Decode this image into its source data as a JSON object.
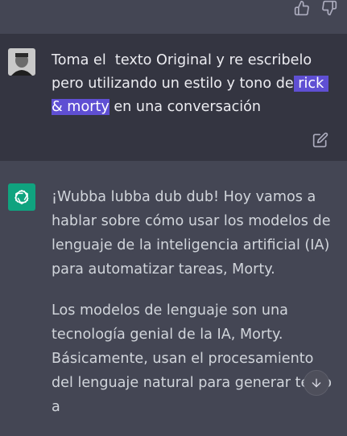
{
  "icons": {
    "thumbs_up": "thumbs-up-icon",
    "thumbs_down": "thumbs-down-icon",
    "edit": "edit-icon",
    "scroll_down": "arrow-down-icon",
    "assistant_logo": "openai-logo-icon"
  },
  "colors": {
    "user_bg": "#343541",
    "assistant_bg": "#444654",
    "selection": "#5f4fd3",
    "assistant_logo_bg": "#10a37f"
  },
  "user_message": {
    "pre": "Toma el  texto Original y re escribelo pero utilizando un estilo y tono de",
    "highlight": " rick & morty",
    "post": " en una conversación"
  },
  "assistant_message": {
    "paragraphs": [
      "¡Wubba lubba dub dub! Hoy vamos a hablar sobre cómo usar los modelos de lenguaje de la inteligencia artificial (IA) para automatizar tareas, Morty.",
      "Los modelos de lenguaje son una tecnología genial de la IA, Morty. Básicamente, usan el procesamiento del lenguaje natural para generar texto a"
    ]
  }
}
